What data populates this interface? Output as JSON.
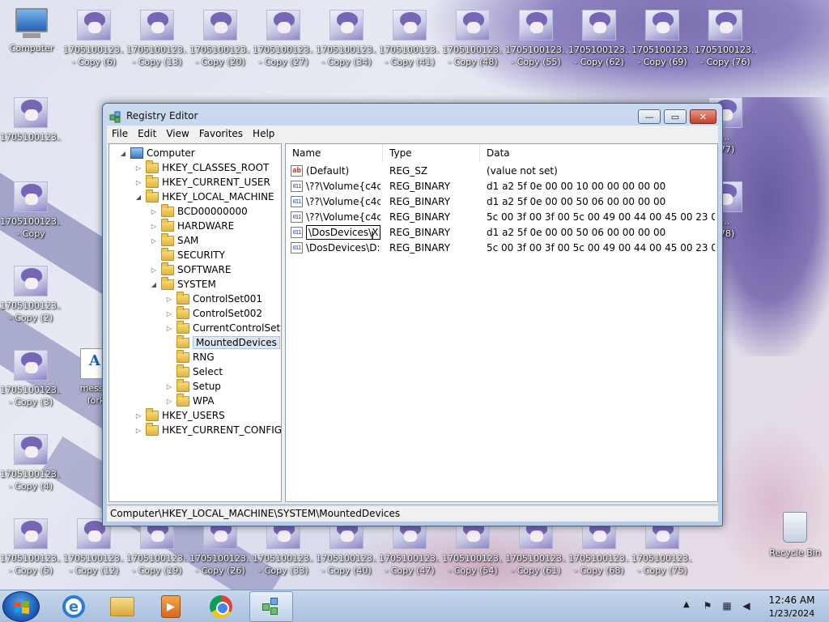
{
  "desktop": {
    "computer_label": "Computer",
    "recycle_label": "Recycle Bin",
    "icons": [
      {
        "label": "1705100123...\n- Copy (6)",
        "col": 1,
        "row": 0
      },
      {
        "label": "1705100123...\n- Copy (13)",
        "col": 2,
        "row": 0
      },
      {
        "label": "1705100123...\n- Copy (20)",
        "col": 3,
        "row": 0
      },
      {
        "label": "1705100123...\n- Copy (27)",
        "col": 4,
        "row": 0
      },
      {
        "label": "1705100123...\n- Copy (34)",
        "col": 5,
        "row": 0
      },
      {
        "label": "1705100123...\n- Copy (41)",
        "col": 6,
        "row": 0
      },
      {
        "label": "1705100123...\n- Copy (48)",
        "col": 7,
        "row": 0
      },
      {
        "label": "1705100123...\n- Copy (55)",
        "col": 8,
        "row": 0
      },
      {
        "label": "1705100123...\n- Copy (62)",
        "col": 9,
        "row": 0
      },
      {
        "label": "1705100123...\n- Copy (69)",
        "col": 10,
        "row": 0
      },
      {
        "label": "1705100123...\n- Copy (76)",
        "col": 11,
        "row": 0
      },
      {
        "label": "1705100123...\n",
        "col": 0,
        "row": 1
      },
      {
        "label": "1705100123...\n- Copy",
        "col": 0,
        "row": 2
      },
      {
        "label": "1705100123...\n- Copy (2)",
        "col": 0,
        "row": 3
      },
      {
        "label": "1705100123...\n- Copy (3)",
        "col": 0,
        "row": 4
      },
      {
        "label": "1705100123...\n- Copy (4)",
        "col": 0,
        "row": 5
      },
      {
        "label": "1705100123...\n- Copy (5)",
        "col": 0,
        "row": 6
      },
      {
        "label": "1705100123...\n- Copy (12)",
        "col": 1,
        "row": 6
      },
      {
        "label": "1705100123...\n- Copy (19)",
        "col": 2,
        "row": 6
      },
      {
        "label": "1705100123...\n- Copy (26)",
        "col": 3,
        "row": 6
      },
      {
        "label": "1705100123...\n- Copy (33)",
        "col": 4,
        "row": 6
      },
      {
        "label": "1705100123...\n- Copy (40)",
        "col": 5,
        "row": 6
      },
      {
        "label": "1705100123...\n- Copy (47)",
        "col": 6,
        "row": 6
      },
      {
        "label": "1705100123...\n- Copy (54)",
        "col": 7,
        "row": 6
      },
      {
        "label": "1705100123...\n- Copy (61)",
        "col": 8,
        "row": 6
      },
      {
        "label": "1705100123...\n- Copy (68)",
        "col": 9,
        "row": 6
      },
      {
        "label": "1705100123...\n- Copy (75)",
        "col": 10,
        "row": 6
      },
      {
        "label": "...\n(77)",
        "col": 11,
        "row": 1
      },
      {
        "label": "...\n(78)",
        "col": 11,
        "row": 2
      }
    ],
    "doc_icon_label": "messag\nforki"
  },
  "window": {
    "title": "Registry Editor",
    "menu": [
      "File",
      "Edit",
      "View",
      "Favorites",
      "Help"
    ],
    "minimize_glyph": "—",
    "maximize_glyph": "▭",
    "close_glyph": "✕",
    "tree": [
      {
        "label": "Computer",
        "level": 0,
        "expander": "◢",
        "kind": "computer"
      },
      {
        "label": "HKEY_CLASSES_ROOT",
        "level": 1,
        "expander": "▷",
        "kind": "folder"
      },
      {
        "label": "HKEY_CURRENT_USER",
        "level": 1,
        "expander": "▷",
        "kind": "folder"
      },
      {
        "label": "HKEY_LOCAL_MACHINE",
        "level": 1,
        "expander": "◢",
        "kind": "folder"
      },
      {
        "label": "BCD00000000",
        "level": 2,
        "expander": "▷",
        "kind": "folder"
      },
      {
        "label": "HARDWARE",
        "level": 2,
        "expander": "▷",
        "kind": "folder"
      },
      {
        "label": "SAM",
        "level": 2,
        "expander": "▷",
        "kind": "folder"
      },
      {
        "label": "SECURITY",
        "level": 2,
        "expander": "",
        "kind": "folder"
      },
      {
        "label": "SOFTWARE",
        "level": 2,
        "expander": "▷",
        "kind": "folder"
      },
      {
        "label": "SYSTEM",
        "level": 2,
        "expander": "◢",
        "kind": "folder"
      },
      {
        "label": "ControlSet001",
        "level": 3,
        "expander": "▷",
        "kind": "folder"
      },
      {
        "label": "ControlSet002",
        "level": 3,
        "expander": "▷",
        "kind": "folder"
      },
      {
        "label": "CurrentControlSet",
        "level": 3,
        "expander": "▷",
        "kind": "folder"
      },
      {
        "label": "MountedDevices",
        "level": 3,
        "expander": "",
        "kind": "folder",
        "selected": true
      },
      {
        "label": "RNG",
        "level": 3,
        "expander": "",
        "kind": "folder"
      },
      {
        "label": "Select",
        "level": 3,
        "expander": "",
        "kind": "folder"
      },
      {
        "label": "Setup",
        "level": 3,
        "expander": "▷",
        "kind": "folder"
      },
      {
        "label": "WPA",
        "level": 3,
        "expander": "▷",
        "kind": "folder"
      },
      {
        "label": "HKEY_USERS",
        "level": 1,
        "expander": "▷",
        "kind": "folder"
      },
      {
        "label": "HKEY_CURRENT_CONFIG",
        "level": 1,
        "expander": "▷",
        "kind": "folder"
      }
    ],
    "columns": {
      "name": "Name",
      "type": "Type",
      "data": "Data"
    },
    "values": [
      {
        "name": "(Default)",
        "type": "REG_SZ",
        "data": "(value not set)",
        "icon": "ab"
      },
      {
        "name": "\\??\\Volume{c4c...",
        "type": "REG_BINARY",
        "data": "d1 a2 5f 0e 00 00 10 00 00 00 00 00",
        "icon": "bin"
      },
      {
        "name": "\\??\\Volume{c4c...",
        "type": "REG_BINARY",
        "data": "d1 a2 5f 0e 00 00 50 06 00 00 00 00",
        "icon": "bin"
      },
      {
        "name": "\\??\\Volume{c4c...",
        "type": "REG_BINARY",
        "data": "5c 00 3f 00 3f 00 5c 00 49 00 44 00 45 00 23 00 43 00 ...",
        "icon": "bin"
      },
      {
        "name": "\\DosDevices\\X:",
        "type": "REG_BINARY",
        "data": "d1 a2 5f 0e 00 00 50 06 00 00 00 00",
        "icon": "bin",
        "editing": true
      },
      {
        "name": "\\DosDevices\\D:",
        "type": "REG_BINARY",
        "data": "5c 00 3f 00 3f 00 5c 00 49 00 44 00 45 00 23 00 43 00 ...",
        "icon": "bin"
      }
    ],
    "status_path": "Computer\\HKEY_LOCAL_MACHINE\\SYSTEM\\MountedDevices"
  },
  "taskbar": {
    "clock_time": "12:46 AM",
    "clock_date": "1/23/2024",
    "tray_arrow": "▲",
    "tray_icons": [
      "flag-icon",
      "network-icon",
      "volume-icon"
    ]
  }
}
